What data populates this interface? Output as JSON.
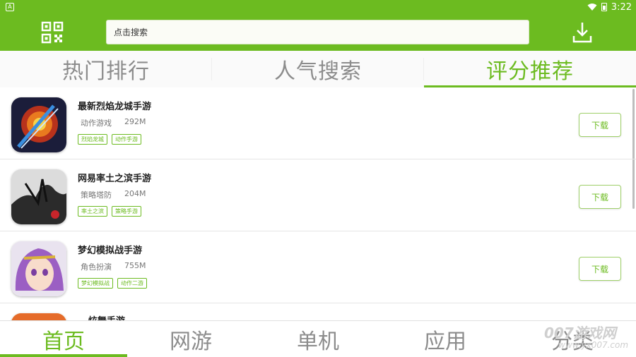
{
  "status_bar": {
    "left_icon": "A",
    "time": "3:22"
  },
  "top_bar": {
    "search_placeholder": "点击搜索"
  },
  "tabs": [
    {
      "label": "热门排行",
      "active": false
    },
    {
      "label": "人气搜索",
      "active": false
    },
    {
      "label": "评分推荐",
      "active": true
    }
  ],
  "apps": [
    {
      "name": "最新烈焰龙城手游",
      "category": "动作游戏",
      "size": "292M",
      "tags": [
        "烈焰龙城",
        "动作手游"
      ],
      "download_label": "下载"
    },
    {
      "name": "网易率土之滨手游",
      "category": "策略塔防",
      "size": "204M",
      "tags": [
        "率土之滨",
        "策略手游"
      ],
      "download_label": "下载"
    },
    {
      "name": "梦幻模拟战手游",
      "category": "角色扮演",
      "size": "755M",
      "tags": [
        "梦幻模拟战",
        "动作二游"
      ],
      "download_label": "下载"
    },
    {
      "name": "...炫舞手游"
    }
  ],
  "bottom_nav": [
    {
      "label": "首页",
      "active": true
    },
    {
      "label": "网游",
      "active": false
    },
    {
      "label": "单机",
      "active": false
    },
    {
      "label": "应用",
      "active": false
    },
    {
      "label": "分类",
      "active": false
    }
  ],
  "watermark": {
    "brand": "007游戏网",
    "url": "www.yx007.com"
  },
  "colors": {
    "accent": "#6cbb20"
  }
}
